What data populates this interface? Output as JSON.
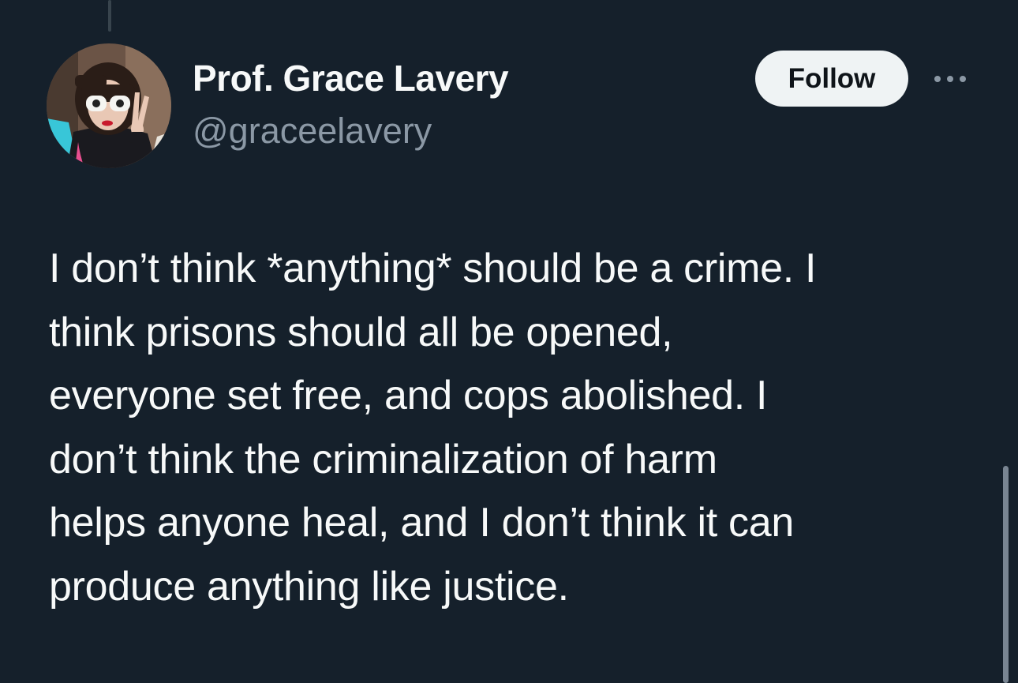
{
  "tweet": {
    "author": {
      "display_name": "Prof. Grace Lavery",
      "handle": "@graceelavery",
      "avatar_icon": "profile-photo"
    },
    "follow_label": "Follow",
    "more_icon": "more-horizontal-icon",
    "text_lines": [
      "I don’t think *anything* should be a crime. I",
      "think prisons should all be opened,",
      "everyone set free, and cops abolished. I",
      "don’t think the criminalization of harm",
      "helps anyone heal, and I don’t think it can",
      "produce anything like justice."
    ]
  },
  "theme": {
    "background": "#15202b",
    "text_primary": "#f7f9f9",
    "text_secondary": "#8b98a5",
    "follow_button_bg": "#eff3f4",
    "follow_button_text": "#0f1419"
  }
}
